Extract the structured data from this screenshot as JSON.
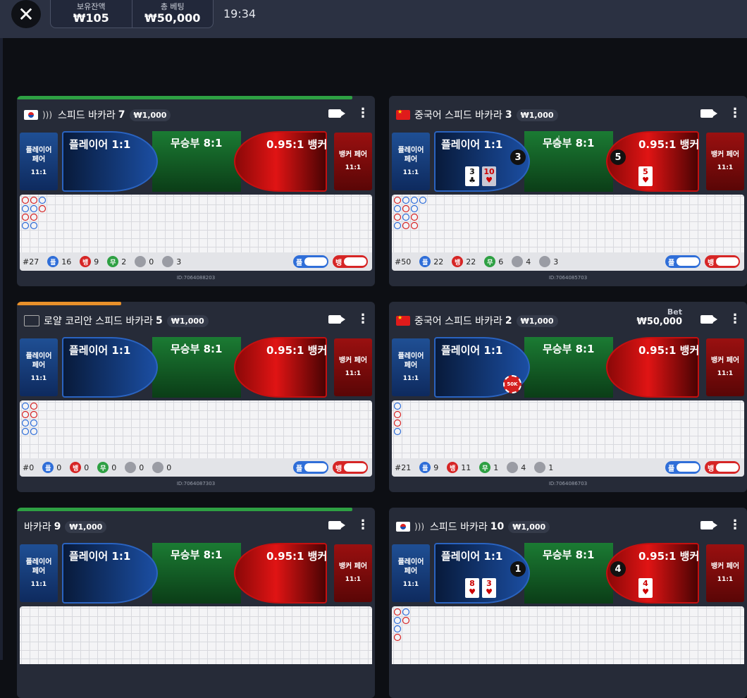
{
  "header": {
    "close_icon": "close-icon",
    "balance_label": "보유잔액",
    "balance_value": "₩105",
    "total_bet_label": "총 베팅",
    "total_bet_value": "₩50,000",
    "time": "19:34"
  },
  "colors": {
    "player": "#1b4ea2",
    "tie": "#1b7b33",
    "banker": "#d31313",
    "top_green": "#2ea043",
    "top_orange": "#e8902a"
  },
  "tables": [
    {
      "flag": "kr",
      "sound": true,
      "name": "스피드 바카라",
      "number": "7",
      "limit": "₩1,000",
      "player_pair": "플레이어\n페어",
      "player_pair_odds": "11:1",
      "player": "플레이어 1:1",
      "tie": "무승부 8:1",
      "banker": "0.95:1 뱅커",
      "banker_pair": "뱅커 페어",
      "banker_pair_odds": "11:1",
      "stats": {
        "round": "#27",
        "p_label": "플",
        "p": "16",
        "b_label": "뱅",
        "b": "9",
        "t_label": "무",
        "t": "2",
        "pp": "0",
        "bp": "3"
      },
      "pred_p": "플",
      "pred_b": "뱅",
      "id": "ID:7064088203",
      "top": "green"
    },
    {
      "flag": "cn",
      "name": "중국어 스피드 바카라",
      "number": "3",
      "limit": "₩1,000",
      "player_pair": "플레이어\n페어",
      "player_pair_odds": "11:1",
      "player": "플레이어 1:1",
      "tie": "무승부 8:1",
      "banker": "0.95:1 뱅커",
      "banker_pair": "뱅커 페어",
      "banker_pair_odds": "11:1",
      "player_score": "3",
      "player_cards": [
        "3",
        "10"
      ],
      "banker_score": "5",
      "banker_cards": [
        "5"
      ],
      "stats": {
        "round": "#50",
        "p_label": "플",
        "p": "22",
        "b_label": "뱅",
        "b": "22",
        "t_label": "무",
        "t": "6",
        "pp": "4",
        "bp": "3"
      },
      "pred_p": "플",
      "pred_b": "뱅",
      "id": "ID:7064085703"
    },
    {
      "flag": "empty",
      "name": "로얄 코리안 스피드 바카라",
      "number": "5",
      "limit": "₩1,000",
      "player_pair": "플레이어\n페어",
      "player_pair_odds": "11:1",
      "player": "플레이어 1:1",
      "tie": "무승부 8:1",
      "banker": "0.95:1 뱅커",
      "banker_pair": "뱅커 페어",
      "banker_pair_odds": "11:1",
      "stats": {
        "round": "#0",
        "p_label": "플",
        "p": "0",
        "b_label": "뱅",
        "b": "0",
        "t_label": "무",
        "t": "0",
        "pp": "0",
        "bp": "0"
      },
      "pred_p": "플",
      "pred_b": "뱅",
      "id": "ID:7064087303",
      "top": "orange"
    },
    {
      "flag": "cn",
      "name": "중국어 스피드 바카라",
      "number": "2",
      "limit": "₩1,000",
      "bet_label": "Bet",
      "bet_amount": "₩50,000",
      "chip": "50K",
      "player_pair": "플레이어\n페어",
      "player_pair_odds": "11:1",
      "player": "플레이어 1:1",
      "tie": "무승부 8:1",
      "banker": "0.95:1 뱅커",
      "banker_pair": "뱅커 페어",
      "banker_pair_odds": "11:1",
      "stats": {
        "round": "#21",
        "p_label": "플",
        "p": "9",
        "b_label": "뱅",
        "b": "11",
        "t_label": "무",
        "t": "1",
        "pp": "4",
        "bp": "1"
      },
      "pred_p": "플",
      "pred_b": "뱅",
      "id": "ID:7064086703"
    },
    {
      "flag": "none",
      "name": "바카라",
      "number": "9",
      "limit": "₩1,000",
      "player_pair": "플레이어\n페어",
      "player_pair_odds": "11:1",
      "player": "플레이어 1:1",
      "tie": "무승부 8:1",
      "banker": "0.95:1 뱅커",
      "banker_pair": "뱅커 페어",
      "banker_pair_odds": "11:1",
      "top": "green"
    },
    {
      "flag": "kr",
      "sound": true,
      "name": "스피드 바카라",
      "number": "10",
      "limit": "₩1,000",
      "player_pair": "플레이어\n페어",
      "player_pair_odds": "11:1",
      "player": "플레이어 1:1",
      "tie": "무승부 8:1",
      "banker": "0.95:1 뱅커",
      "banker_pair": "뱅커 페어",
      "banker_pair_odds": "11:1",
      "player_score": "1",
      "player_cards": [
        "8",
        "3"
      ],
      "banker_score": "4",
      "banker_cards": [
        "4"
      ]
    }
  ]
}
